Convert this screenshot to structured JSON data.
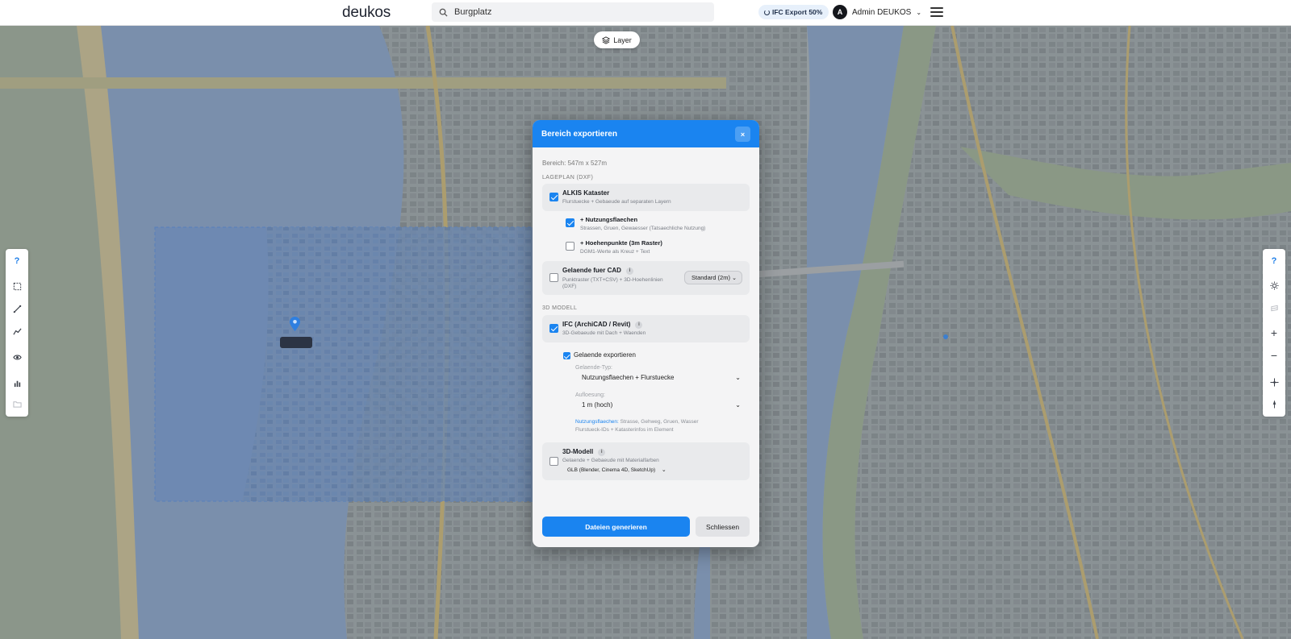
{
  "header": {
    "logo": "deukos",
    "search_value": "Burgplatz",
    "ifc_badge": "IFC Export 50%",
    "user_initial": "A",
    "user_name": "Admin DEUKOS"
  },
  "map": {
    "layer_button": "Layer"
  },
  "left_toolbar": {
    "items": [
      "help-icon",
      "rectangle-select-icon",
      "measure-line-icon",
      "profile-line-icon",
      "eye-icon",
      "bar-chart-icon",
      "folder-icon"
    ],
    "help_label": "?"
  },
  "right_toolbar": {
    "items": [
      "help-icon",
      "sun-icon",
      "layers-icon",
      "zoom-in-icon",
      "zoom-out-icon",
      "crosshair-icon",
      "compass-icon"
    ],
    "help_label": "?",
    "zoom_in_label": "+",
    "zoom_out_label": "−"
  },
  "modal": {
    "title": "Bereich exportieren",
    "close_label": "×",
    "range_text": "Bereich: 547m x 527m",
    "section_lageplan": "LAGEPLAN (DXF)",
    "section_3d": "3D MODELL",
    "alkis": {
      "title": "ALKIS Kataster",
      "subtitle": "Flurstuecke + Gebaeude auf separaten Layern",
      "checked": true
    },
    "nutzung": {
      "title": "+ Nutzungsflaechen",
      "subtitle": "Strassen, Gruen, Gewaesser (Tatsaechliche Nutzung)",
      "checked": true
    },
    "hoehen": {
      "title": "+ Hoehenpunkte (3m Raster)",
      "subtitle": "DGM1-Werte als Kreuz + Text",
      "checked": false
    },
    "gelaende_cad": {
      "title": "Gelaende fuer CAD",
      "info": "i",
      "subtitle_line1": "Punktraster (TXT+CSV) + 3D-Hoehenlinien",
      "subtitle_line2": "(DXF)",
      "select": "Standard (2m)",
      "checked": false
    },
    "ifc": {
      "title": "IFC (ArchiCAD / Revit)",
      "info": "i",
      "subtitle": "3D-Gebaeude mit Dach + Waenden",
      "checked": true,
      "gelaende_export_label": "Gelaende exportieren",
      "gelaende_export_checked": true,
      "typ_label": "Gelaende-Typ:",
      "typ_value": "Nutzungsflaechen + Flurstuecke",
      "aufl_label": "Aufloesung:",
      "aufl_value": "1 m (hoch)",
      "note_hl": "Nutzungsflaechen:",
      "note_rest": " Strasse, Gehweg, Gruen, Wasser",
      "note_line2": "Flurstueck-IDs + Katasterinfos im Element"
    },
    "modell3d": {
      "title": "3D-Modell",
      "info": "i",
      "subtitle": "Gelaende + Gebaeude mit Materialfarben",
      "format": "GLB (Blender, Cinema 4D, SketchUp)",
      "checked": false
    },
    "generate_button": "Dateien generieren",
    "close_button": "Schliessen"
  },
  "colors": {
    "accent": "#1a84f0",
    "header_bg": "#ffffff",
    "modal_bg": "#f4f4f5",
    "water": "#7b93b5",
    "land": "#9aa3a6",
    "selection": "#5f8fd0"
  }
}
